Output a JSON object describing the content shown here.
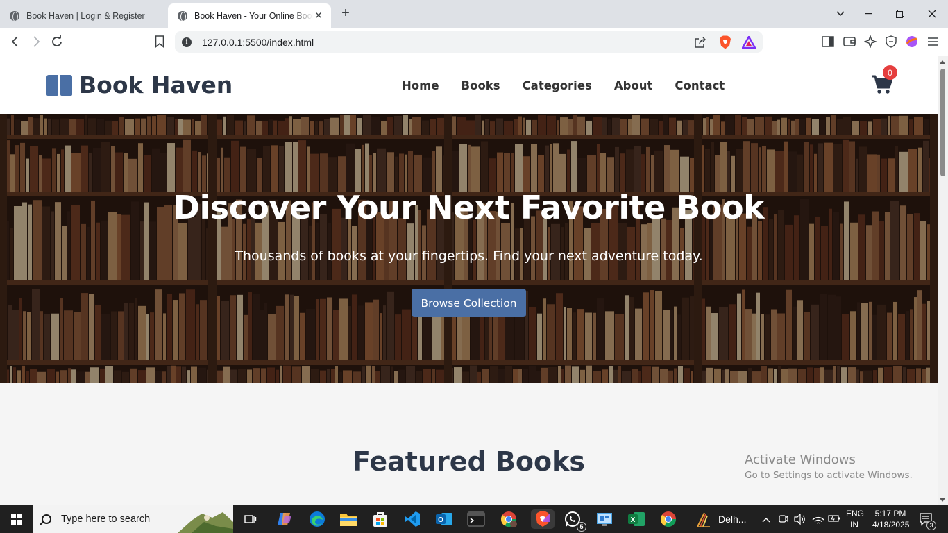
{
  "browser": {
    "tabs": [
      {
        "title": "Book Haven | Login & Register",
        "active": false
      },
      {
        "title": "Book Haven - Your Online Bookstore",
        "active": true
      }
    ],
    "url": "127.0.0.1:5500/index.html"
  },
  "site": {
    "logo_text": "Book Haven",
    "nav": [
      "Home",
      "Books",
      "Categories",
      "About",
      "Contact"
    ],
    "cart_count": "0",
    "hero": {
      "title": "Discover Your Next Favorite Book",
      "subtitle": "Thousands of books at your fingertips. Find your next adventure today.",
      "button": "Browse Collection"
    },
    "featured_title": "Featured Books",
    "colors": {
      "accent": "#4a6fa5",
      "heading": "#2d3748",
      "badge": "#e53e3e"
    }
  },
  "watermark": {
    "line1": "Activate Windows",
    "line2": "Go to Settings to activate Windows."
  },
  "taskbar": {
    "search_placeholder": "Type here to search",
    "weather": "Delh...",
    "lang1": "ENG",
    "lang2": "IN",
    "time": "5:17 PM",
    "date": "4/18/2025",
    "notifications": "3",
    "whatsapp_badge": "5"
  }
}
